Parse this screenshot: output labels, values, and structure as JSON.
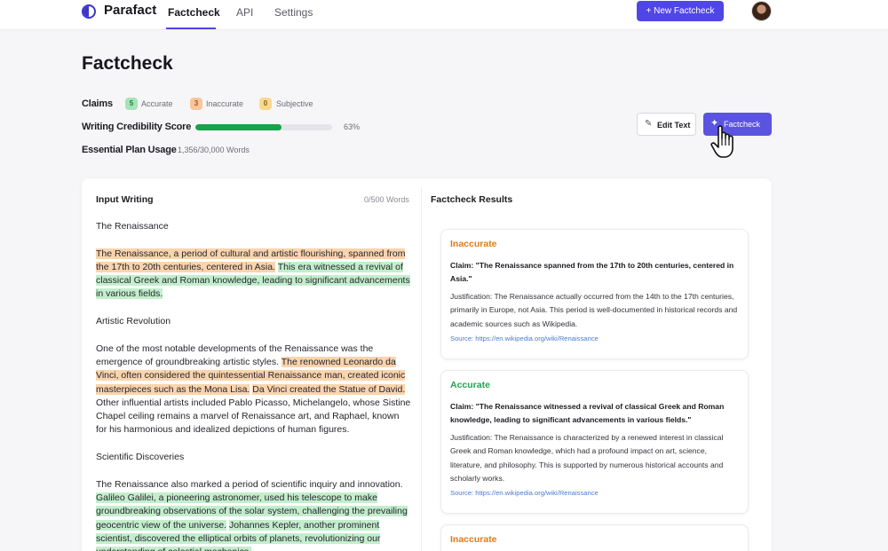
{
  "app": {
    "brand": "Parafact",
    "nav": {
      "factcheck": "Factcheck",
      "api": "API",
      "settings": "Settings"
    },
    "new_button": "+ New Factcheck"
  },
  "page": {
    "title": "Factcheck"
  },
  "stats": {
    "claims_label": "Claims",
    "accurate_count": "5",
    "accurate_label": "Accurate",
    "inaccurate_count": "3",
    "inaccurate_label": "Inaccurate",
    "subjective_count": "0",
    "subjective_label": "Subjective",
    "credibility_label": "Writing Credibility Score",
    "credibility_percent": "63%",
    "credibility_value": 0.63,
    "usage_label": "Essential Plan Usage",
    "usage_value": "1,356/30,000 Words"
  },
  "actions": {
    "edit": "Edit Text",
    "factcheck": "Factcheck"
  },
  "input": {
    "title": "Input Writing",
    "word_count": "0/500 Words",
    "heading1": "The Renaissance",
    "p1_s1": "The Renaissance, a period of cultural and artistic flourishing, spanned from the 17th to 20th centuries, centered in Asia.",
    "p1_s2": "This era witnessed a revival of classical Greek and Roman knowledge, leading to significant advancements in various fields.",
    "heading2": "Artistic Revolution",
    "p2_s1": "One of the most notable developments of the Renaissance was the emergence of groundbreaking artistic styles.",
    "p2_s2": "The renowned Leonardo da Vinci, often considered the quintessential Renaissance man, created iconic masterpieces such as the Mona Lisa.",
    "p2_s3": "Da Vinci created the Statue of David.",
    "p2_s4": "Other influential artists included Pablo Picasso, Michelangelo, whose Sistine Chapel ceiling remains a marvel of Renaissance art, and Raphael, known for his harmonious and idealized depictions of human figures.",
    "heading3": "Scientific Discoveries",
    "p3_s1": "The Renaissance also marked a period of scientific inquiry and innovation.",
    "p3_s2": "Galileo Galilei, a pioneering astronomer, used his telescope to make groundbreaking observations of the solar system, challenging the prevailing geocentric view of the universe.",
    "p3_s3": "Johannes Kepler, another prominent scientist, discovered the elliptical orbits of planets, revolutionizing our understanding of celestial mechanics."
  },
  "results": {
    "title": "Factcheck Results",
    "items": [
      {
        "status": "Inaccurate",
        "claim": "Claim: \"The Renaissance spanned from the 17th to 20th centuries, centered in Asia.\"",
        "justification": "Justification: The Renaissance actually occurred from the 14th to the 17th centuries, primarily in Europe, not Asia. This period is well-documented in historical records and academic sources such as Wikipedia.",
        "source": "Source: https://en.wikipedia.org/wiki/Renaissance"
      },
      {
        "status": "Accurate",
        "claim": "Claim: \"The Renaissance witnessed a revival of classical Greek and Roman knowledge, leading to significant advancements in various fields.\"",
        "justification": "Justification: The Renaissance is characterized by a renewed interest in classical Greek and Roman knowledge, which had a profound impact on art, science, literature, and philosophy. This is supported by numerous historical accounts and scholarly works.",
        "source": "Source: https://en.wikipedia.org/wiki/Renaissance"
      },
      {
        "status": "Inaccurate"
      }
    ]
  },
  "colors": {
    "accent": "#4f46e5",
    "accurate": "#22a34f",
    "inaccurate": "#e07b1a",
    "progress": "#16a34a"
  }
}
